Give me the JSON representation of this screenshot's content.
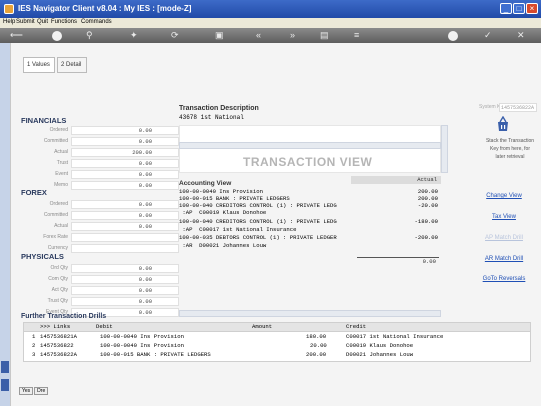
{
  "window": {
    "title": "IES Navigator Client v8.04 : My IES :     [mode-Z]"
  },
  "menu": [
    "Help",
    "Submit",
    "Quit",
    "Functions",
    "Commands"
  ],
  "tabs": [
    {
      "label": "1 Values"
    },
    {
      "label": "2 Detail"
    }
  ],
  "financials": {
    "title": "FINANCIALS",
    "fields": [
      {
        "label": "Ordered",
        "value": "0.00"
      },
      {
        "label": "Committed",
        "value": "0.00"
      },
      {
        "label": "Actual",
        "value": "200.00"
      },
      {
        "label": "Trust",
        "value": "0.00"
      },
      {
        "label": "Event",
        "value": "0.00"
      },
      {
        "label": "Memo",
        "value": "0.00"
      }
    ]
  },
  "forex": {
    "title": "FOREX",
    "fields": [
      {
        "label": "Ordered",
        "value": "0.00"
      },
      {
        "label": "Committed",
        "value": "0.00"
      },
      {
        "label": "Actual",
        "value": "0.00"
      },
      {
        "label": "Forex Rate",
        "value": ""
      },
      {
        "label": "Currency",
        "value": ""
      }
    ]
  },
  "physicals": {
    "title": "PHYSICALS",
    "fields": [
      {
        "label": "Ord Qty",
        "value": "0.00"
      },
      {
        "label": "Com Qty",
        "value": "0.00"
      },
      {
        "label": "Act Qty",
        "value": "0.00"
      },
      {
        "label": "Trust Qty",
        "value": "0.00"
      },
      {
        "label": "Event Qty",
        "value": "0.00"
      }
    ]
  },
  "transaction": {
    "desc_label": "Transaction Description",
    "desc_value": "43678 1st National",
    "watermark": "TRANSACTION VIEW",
    "system_key_label": "System Key",
    "system_key_value": "1457536822A"
  },
  "accounting": {
    "title": "Accounting View",
    "col_header": "Actual",
    "rows": [
      {
        "text": "100-00-0040 Ins Provision",
        "amount": "200.00"
      },
      {
        "text": "100-00-015 BANK : PRIVATE LEDGERS",
        "amount": "200.00"
      },
      {
        "text": "100-00-040 CREDITORS CONTROL (1) : PRIVATE LEDG",
        "amount": "-20.00"
      },
      {
        "text": " :AP  C00019 Klaus Donohoe",
        "amount": ""
      },
      {
        "text": "100-00-040 CREDITORS CONTROL (1) : PRIVATE LEDG",
        "amount": "-180.00"
      },
      {
        "text": " :AP  C00017 1st National Insurance",
        "amount": ""
      },
      {
        "text": "100-00-035 DEBTORS CONTROL (1) : PRIVATE LEDGER",
        "amount": "-200.00"
      },
      {
        "text": " :AR  D00021 Johannes Louw",
        "amount": ""
      }
    ],
    "total": "0.00"
  },
  "side": {
    "stack_text": [
      "Stack the Transaction",
      "Key from here, for",
      "later retrieval"
    ],
    "links": [
      {
        "label": "Change View",
        "enabled": true
      },
      {
        "label": "Tax View",
        "enabled": true
      },
      {
        "label": "AP Match Drill",
        "enabled": false
      },
      {
        "label": "AR Match Drill",
        "enabled": true
      },
      {
        "label": "GoTo Reversals",
        "enabled": true
      }
    ]
  },
  "drills": {
    "title": "Further Transaction Drills",
    "headers": {
      "links": ">>> Links",
      "debit": "Debit",
      "amount": "Amount",
      "credit": "Credit"
    },
    "rows": [
      {
        "num": "1",
        "link": "1457536821A",
        "debit": "100-00-0040 Ins Provision",
        "amount": "180.00",
        "credit": "C00017 1st National Insurance"
      },
      {
        "num": "2",
        "link": "1457536822",
        "debit": "100-00-0040 Ins Provision",
        "amount": "20.00",
        "credit": "C00019 Klaus Donohoe"
      },
      {
        "num": "3",
        "link": "1457536822A",
        "debit": "100-00-015 BANK : PRIVATE LEDGERS",
        "amount": "200.00",
        "credit": "D00021 Johannes Louw"
      }
    ]
  },
  "bottom_buttons": [
    "Yes",
    "Dre"
  ]
}
